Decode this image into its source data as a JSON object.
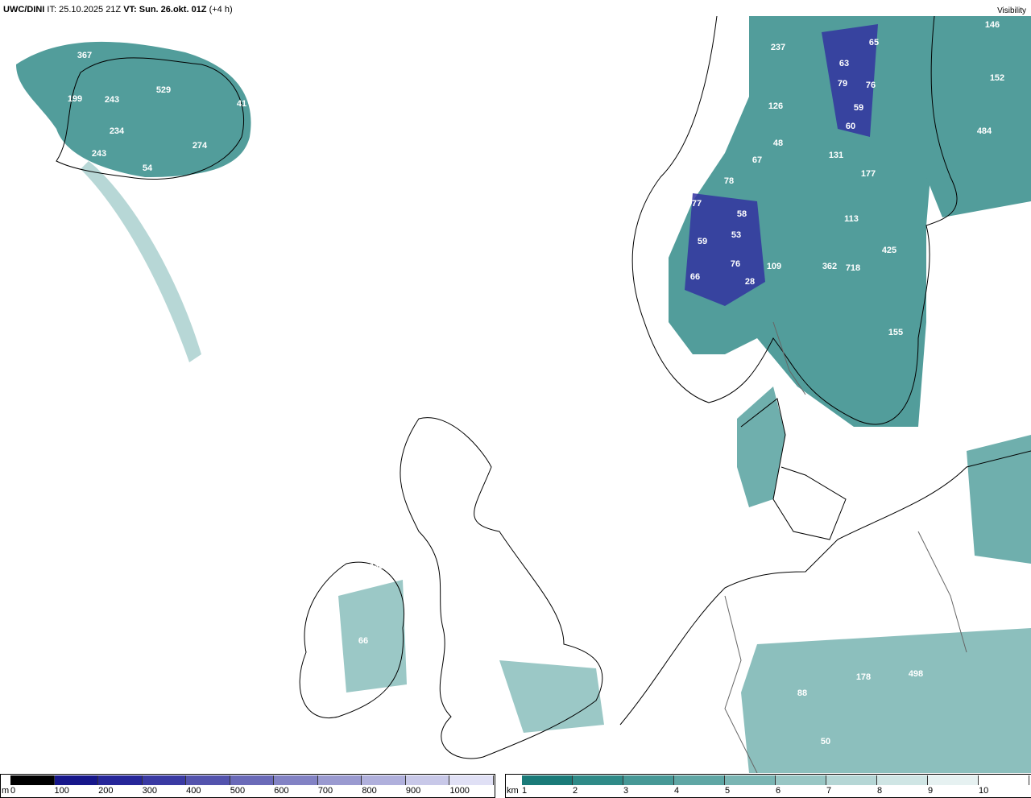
{
  "header": {
    "model": "UWC/DINI",
    "it_label": "IT:",
    "it_value": "25.10.2025 21Z",
    "vt_label": "VT:",
    "vt_value": "Sun. 26.okt. 01Z",
    "offset": "(+4 h)",
    "parameter": "Visibility"
  },
  "map_labels": [
    "367",
    "529",
    "199",
    "243",
    "41",
    "234",
    "274",
    "243",
    "54",
    "237",
    "65",
    "63",
    "79",
    "76",
    "59",
    "126",
    "60",
    "146",
    "152",
    "484",
    "48",
    "67",
    "131",
    "177",
    "78",
    "77",
    "58",
    "113",
    "59",
    "53",
    "425",
    "76",
    "109",
    "362",
    "718",
    "66",
    "28",
    "155",
    "433",
    "66",
    "178",
    "498",
    "88",
    "50"
  ],
  "legend_m": {
    "unit": "m",
    "ticks": [
      "0",
      "100",
      "200",
      "300",
      "400",
      "500",
      "600",
      "700",
      "800",
      "900",
      "1000"
    ],
    "colors": [
      "#000000",
      "#16168a",
      "#262699",
      "#3a3aa3",
      "#5353ad",
      "#6a6ab8",
      "#8282c4",
      "#9a9ad0",
      "#b0b0dc",
      "#c8c8e8",
      "#e0e0f5"
    ]
  },
  "legend_km": {
    "unit": "km",
    "ticks": [
      "1",
      "2",
      "3",
      "4",
      "5",
      "6",
      "7",
      "8",
      "9",
      "10"
    ],
    "colors": [
      "#1a7a78",
      "#2f8a87",
      "#479896",
      "#5fa6a4",
      "#7ab5b3",
      "#98c6c4",
      "#b5d6d5",
      "#cfe5e4",
      "#e6f1f1",
      "#ffffff"
    ]
  }
}
